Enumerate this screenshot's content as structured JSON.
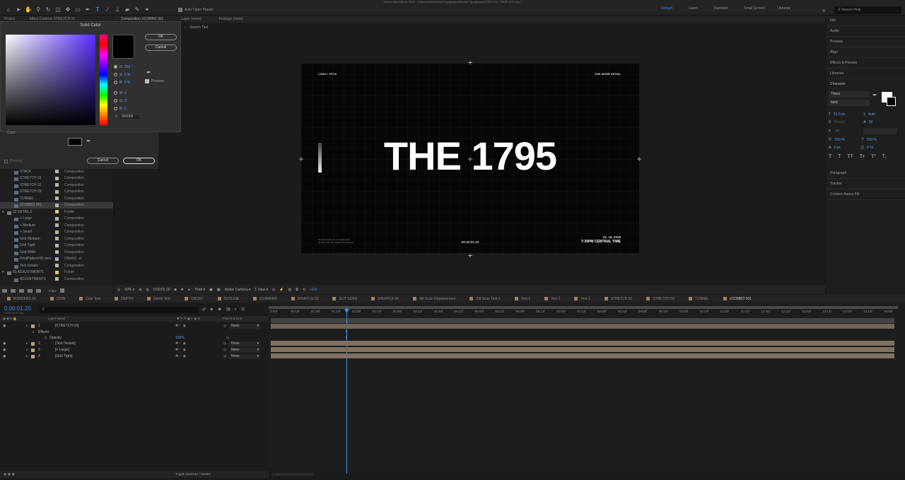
{
  "app": {
    "title": "Adobe After Effects 2020 - /Users/Justin/Motion/Typography/Stretch Typography/STRETCH_TEMPLATE.aep *"
  },
  "toolbar": {
    "auto_open_label": "Auto-Open Panels",
    "workspaces": [
      "Default",
      "Learn",
      "Standard",
      "Small Screen",
      "Libraries"
    ],
    "active_workspace": "Default",
    "search_placeholder": "Search Help"
  },
  "panels": {
    "project_tab": "Project",
    "effect_controls_tab": "Effect Controls STRETCH 01",
    "composition_tab": "Composition zCOMBO 001",
    "layer_tab": "Layer (none)",
    "footage_tab": "Footage (none)",
    "breadcrumb": "Stretch Text"
  },
  "color_dialog": {
    "title": "Solid Color",
    "ok": "OK",
    "cancel": "Cancel",
    "h_label": "H:",
    "h_value": "252 °",
    "s_label": "S:",
    "s_value": "0 %",
    "b_label": "B:",
    "b_value": "0 %",
    "r_label": "R:",
    "r_value": "0",
    "g_label": "G:",
    "g_value": "0",
    "b2_label": "B:",
    "b2_value": "0",
    "hex_label": "#",
    "hex_value": "000000",
    "preview_label": "Preview"
  },
  "settings_dialog": {
    "color_label": "Color",
    "preview_label": "Preview",
    "cancel": "Cancel",
    "ok": "OK"
  },
  "project_items": [
    {
      "name": "STACK",
      "type": "Composition",
      "color": "#b9b8a0",
      "kind": "comp"
    },
    {
      "name": "STRETCH 01",
      "type": "Composition",
      "color": "#b9b8a0",
      "kind": "comp"
    },
    {
      "name": "STRETCH 02",
      "type": "Composition",
      "color": "#b9b8a0",
      "kind": "comp"
    },
    {
      "name": "STRETCH 03",
      "type": "Composition",
      "color": "#b9b8a0",
      "kind": "comp"
    },
    {
      "name": "TUNNEL",
      "type": "Composition",
      "color": "#b9b8a0",
      "kind": "comp"
    },
    {
      "name": "zCOMBO 001",
      "type": "Composition",
      "color": "#b9b8a0",
      "kind": "comp",
      "selected": true
    },
    {
      "name": "02 DETAILS",
      "type": "Folder",
      "color": "#d8c76a",
      "kind": "folder"
    },
    {
      "name": "+ Large",
      "type": "Composition",
      "color": "#b9b8a0",
      "kind": "comp"
    },
    {
      "name": "+ Medium",
      "type": "Composition",
      "color": "#b9b8a0",
      "kind": "comp"
    },
    {
      "name": "+ Small",
      "type": "Composition",
      "color": "#b9b8a0",
      "kind": "comp"
    },
    {
      "name": "Grid Medium",
      "type": "Composition",
      "color": "#b9b8a0",
      "kind": "comp"
    },
    {
      "name": "Grid Tight",
      "type": "Composition",
      "color": "#b9b8a0",
      "kind": "comp"
    },
    {
      "name": "Grid Wide",
      "type": "Composition",
      "color": "#b9b8a0",
      "kind": "comp"
    },
    {
      "name": "PrintPatternHD.mov",
      "type": "DNxHD...rt",
      "color": "#9fb4c9",
      "kind": "file"
    },
    {
      "name": "Text Details",
      "type": "Composition",
      "color": "#b9b8a0",
      "kind": "comp"
    },
    {
      "name": "03 ADJUSTMENTS",
      "type": "Folder",
      "color": "#d8c76a",
      "kind": "folder"
    },
    {
      "name": "ADJUSTMENTS",
      "type": "Composition",
      "color": "#b9b8a0",
      "kind": "comp"
    }
  ],
  "project_footer": {
    "bpc": "8 bpc"
  },
  "composition": {
    "logo_text": "LOGO / TITLE",
    "detail_text": "ONE MORE DETAIL",
    "main_text": "THE 1795",
    "small_print_1": "Small text details and more details about",
    "small_print_2": "the event, date, time, location and more here",
    "timecode_text": "00:00:01:20",
    "date_text": "01. 15. 2020",
    "time_text": "7:30PM CENTRAL TIME"
  },
  "viewer_footer": {
    "zoom": "50%",
    "timecode": "0:00:01:20",
    "resolution": "Third",
    "camera": "Active Camera",
    "views": "1 View",
    "exposure": "+0.0"
  },
  "right_panels": [
    {
      "label": "Info"
    },
    {
      "label": "Audio"
    },
    {
      "label": "Preview"
    },
    {
      "label": "Align"
    },
    {
      "label": "Effects & Presets"
    },
    {
      "label": "Libraries"
    }
  ],
  "character": {
    "title": "Character",
    "font": "Times",
    "style": "Italic",
    "size": "51.5 px",
    "leading": "Auto",
    "kerning": "Metrics",
    "tracking": "50",
    "stroke": "- px",
    "vscale": "100 %",
    "hscale": "100 %",
    "baseline": "0 px",
    "tsume": "0 %"
  },
  "right_panels_bottom": [
    {
      "label": "Paragraph"
    },
    {
      "label": "Tracker"
    },
    {
      "label": "Content-Aware Fill"
    }
  ],
  "timeline_tabs": [
    "BORDERS 02",
    "COIN",
    "Coin Text",
    "DEPTH",
    "Depth Text",
    "GHOST",
    "OUTLINE",
    "SCANNER",
    "SHUFFLE 03",
    "SLIT SCAN",
    "SHUFFLE 04",
    "Slit Scan Displacement",
    "Slit Scan Text 1",
    "Text 1",
    "Text 2",
    "Text 3",
    "STRETCH 01",
    "STRETCH 03",
    "TUNNEL",
    "zCOMBO 001"
  ],
  "active_tab": "zCOMBO 001",
  "timeline": {
    "timecode": "0:00:01:20",
    "timecode_sub": "00050 (29.97 fps)",
    "layer_name_header": "Layer Name",
    "parent_header": "Parent & Link",
    "toggle_label": "Toggle Switches / Modes",
    "ruler": [
      "0:00f",
      "00:12f",
      "01:00f",
      "01:12f",
      "02:00f",
      "02:12f",
      "03:00f",
      "03:12f",
      "04:00f",
      "04:12f",
      "05:00f",
      "05:12f",
      "06:00f",
      "06:12f",
      "07:00f",
      "07:12f",
      "08:00f",
      "08:12f",
      "09:00f",
      "09:12f",
      "10:00f",
      "10:12f",
      "11:00f",
      "11:12f",
      "12:00f",
      "12:12f",
      "13:00f",
      "13:12f",
      "14:00f",
      "14:12f",
      "15:00f"
    ],
    "layers": [
      {
        "num": "1",
        "name": "[STRETCH 03]",
        "parent": "None"
      },
      {
        "num": "2",
        "name": "[Text Details]",
        "parent": "None"
      },
      {
        "num": "3",
        "name": "[+ Large]",
        "parent": "None"
      },
      {
        "num": "4",
        "name": "[Grid Tight]",
        "parent": "None"
      }
    ],
    "effects_label": "Effects",
    "opacity_label": "Opacity",
    "opacity_value": "100%"
  }
}
